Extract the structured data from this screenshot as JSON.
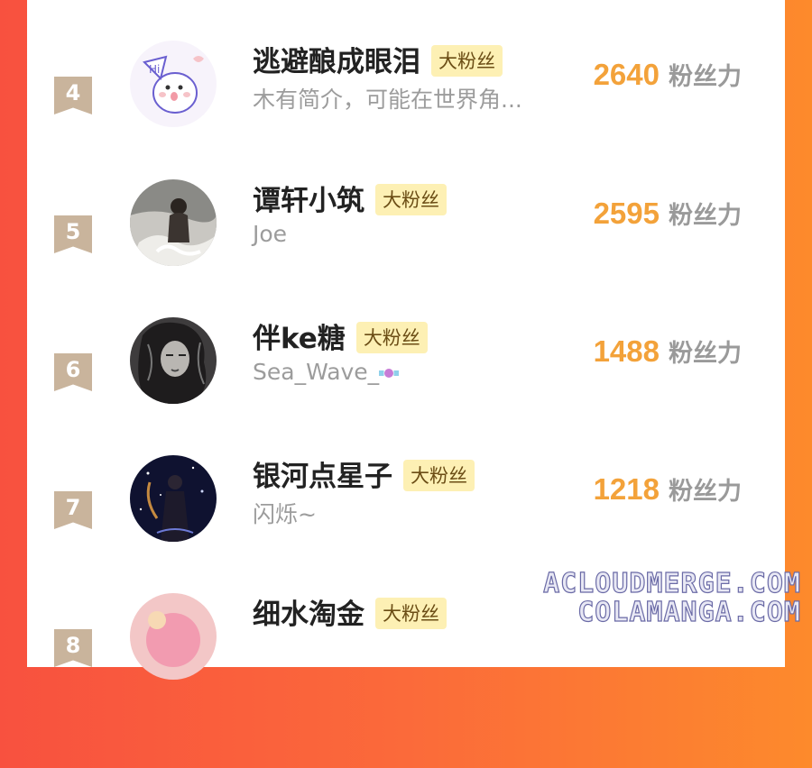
{
  "colors": {
    "accent_score": "#f3a23a",
    "badge_bg": "#fdf0b4",
    "rank_bg": "#c9b49c"
  },
  "list": {
    "items": [
      {
        "rank": "4",
        "name": "逃避酿成眼泪",
        "badge": "大粉丝",
        "bio": "木有简介，可能在世界角...",
        "score": "2640",
        "unit": "粉丝力"
      },
      {
        "rank": "5",
        "name": "谭轩小筑",
        "badge": "大粉丝",
        "bio": "Joe",
        "score": "2595",
        "unit": "粉丝力"
      },
      {
        "rank": "6",
        "name": "伴ke糖",
        "badge": "大粉丝",
        "bio": "Sea_Wave_",
        "score": "1488",
        "unit": "粉丝力"
      },
      {
        "rank": "7",
        "name": "银河点星子",
        "badge": "大粉丝",
        "bio": "闪烁~",
        "score": "1218",
        "unit": "粉丝力"
      },
      {
        "rank": "8",
        "name": "细水淘金",
        "badge": "大粉丝"
      }
    ]
  },
  "watermark": {
    "line1": "ACLOUDMERGE.COM",
    "line2": "COLAMANGA.COM"
  }
}
